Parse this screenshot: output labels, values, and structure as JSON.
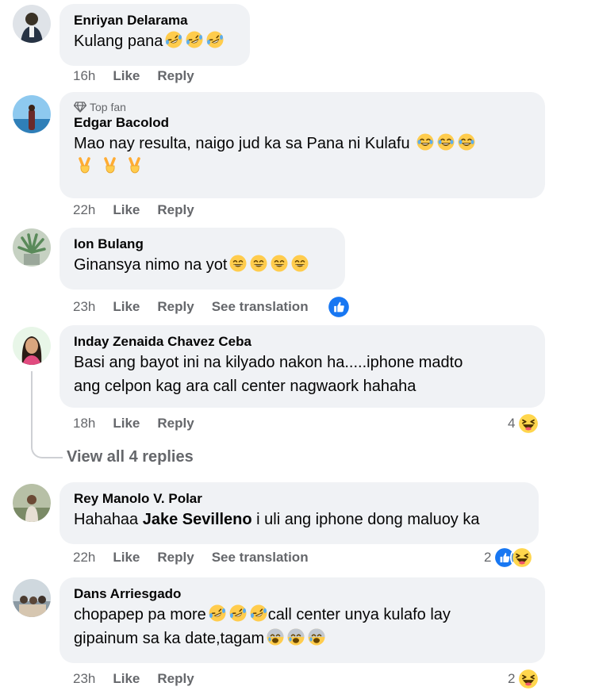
{
  "comments": [
    {
      "name": "Enriyan Delarama",
      "text": "Kulang pana",
      "emoji": [
        "rofl",
        "rofl",
        "rofl"
      ],
      "time": "16h",
      "like": "Like",
      "reply": "Reply"
    },
    {
      "badge": "Top fan",
      "name": "Edgar Bacolod",
      "text": "Mao nay resulta, naigo jud ka sa Pana ni Kulafu",
      "emoji": [
        "joy",
        "joy",
        "joy"
      ],
      "emoji2": [
        "victory",
        "victory",
        "victory"
      ],
      "time": "22h",
      "like": "Like",
      "reply": "Reply"
    },
    {
      "name": "Ion Bulang",
      "text": "Ginansya nimo na yot",
      "emoji": [
        "grin",
        "grin",
        "grin",
        "grin"
      ],
      "time": "23h",
      "like": "Like",
      "reply": "Reply",
      "translate": "See translation"
    },
    {
      "name": "Inday Zenaida Chavez Ceba",
      "line1": "Basi ang bayot ini na kilyado nakon ha.....iphone madto",
      "line2": "ang celpon kag ara call center nagwaork hahaha",
      "time": "18h",
      "like": "Like",
      "reply": "Reply",
      "reaction_count": "4",
      "view_replies": "View all 4 replies"
    },
    {
      "name": "Rey Manolo V. Polar",
      "text_before": "Hahahaa ",
      "mention": "Jake Sevilleno",
      "text_after": " i uli ang iphone dong maluoy ka",
      "time": "22h",
      "like": "Like",
      "reply": "Reply",
      "translate": "See translation",
      "reaction_count": "2"
    },
    {
      "name": "Dans Arriesgado",
      "line1_a": "chopapep pa more",
      "line1_b": "call center unya kulafo lay",
      "line2": "gipainum sa ka date,tagam",
      "time": "23h",
      "like": "Like",
      "reply": "Reply",
      "reaction_count": "2"
    }
  ],
  "colors": {
    "bubble": "#f0f2f5",
    "meta": "#65676b",
    "like_blue": "#1877f2",
    "emoji_yellow": "#ffcc4d"
  }
}
